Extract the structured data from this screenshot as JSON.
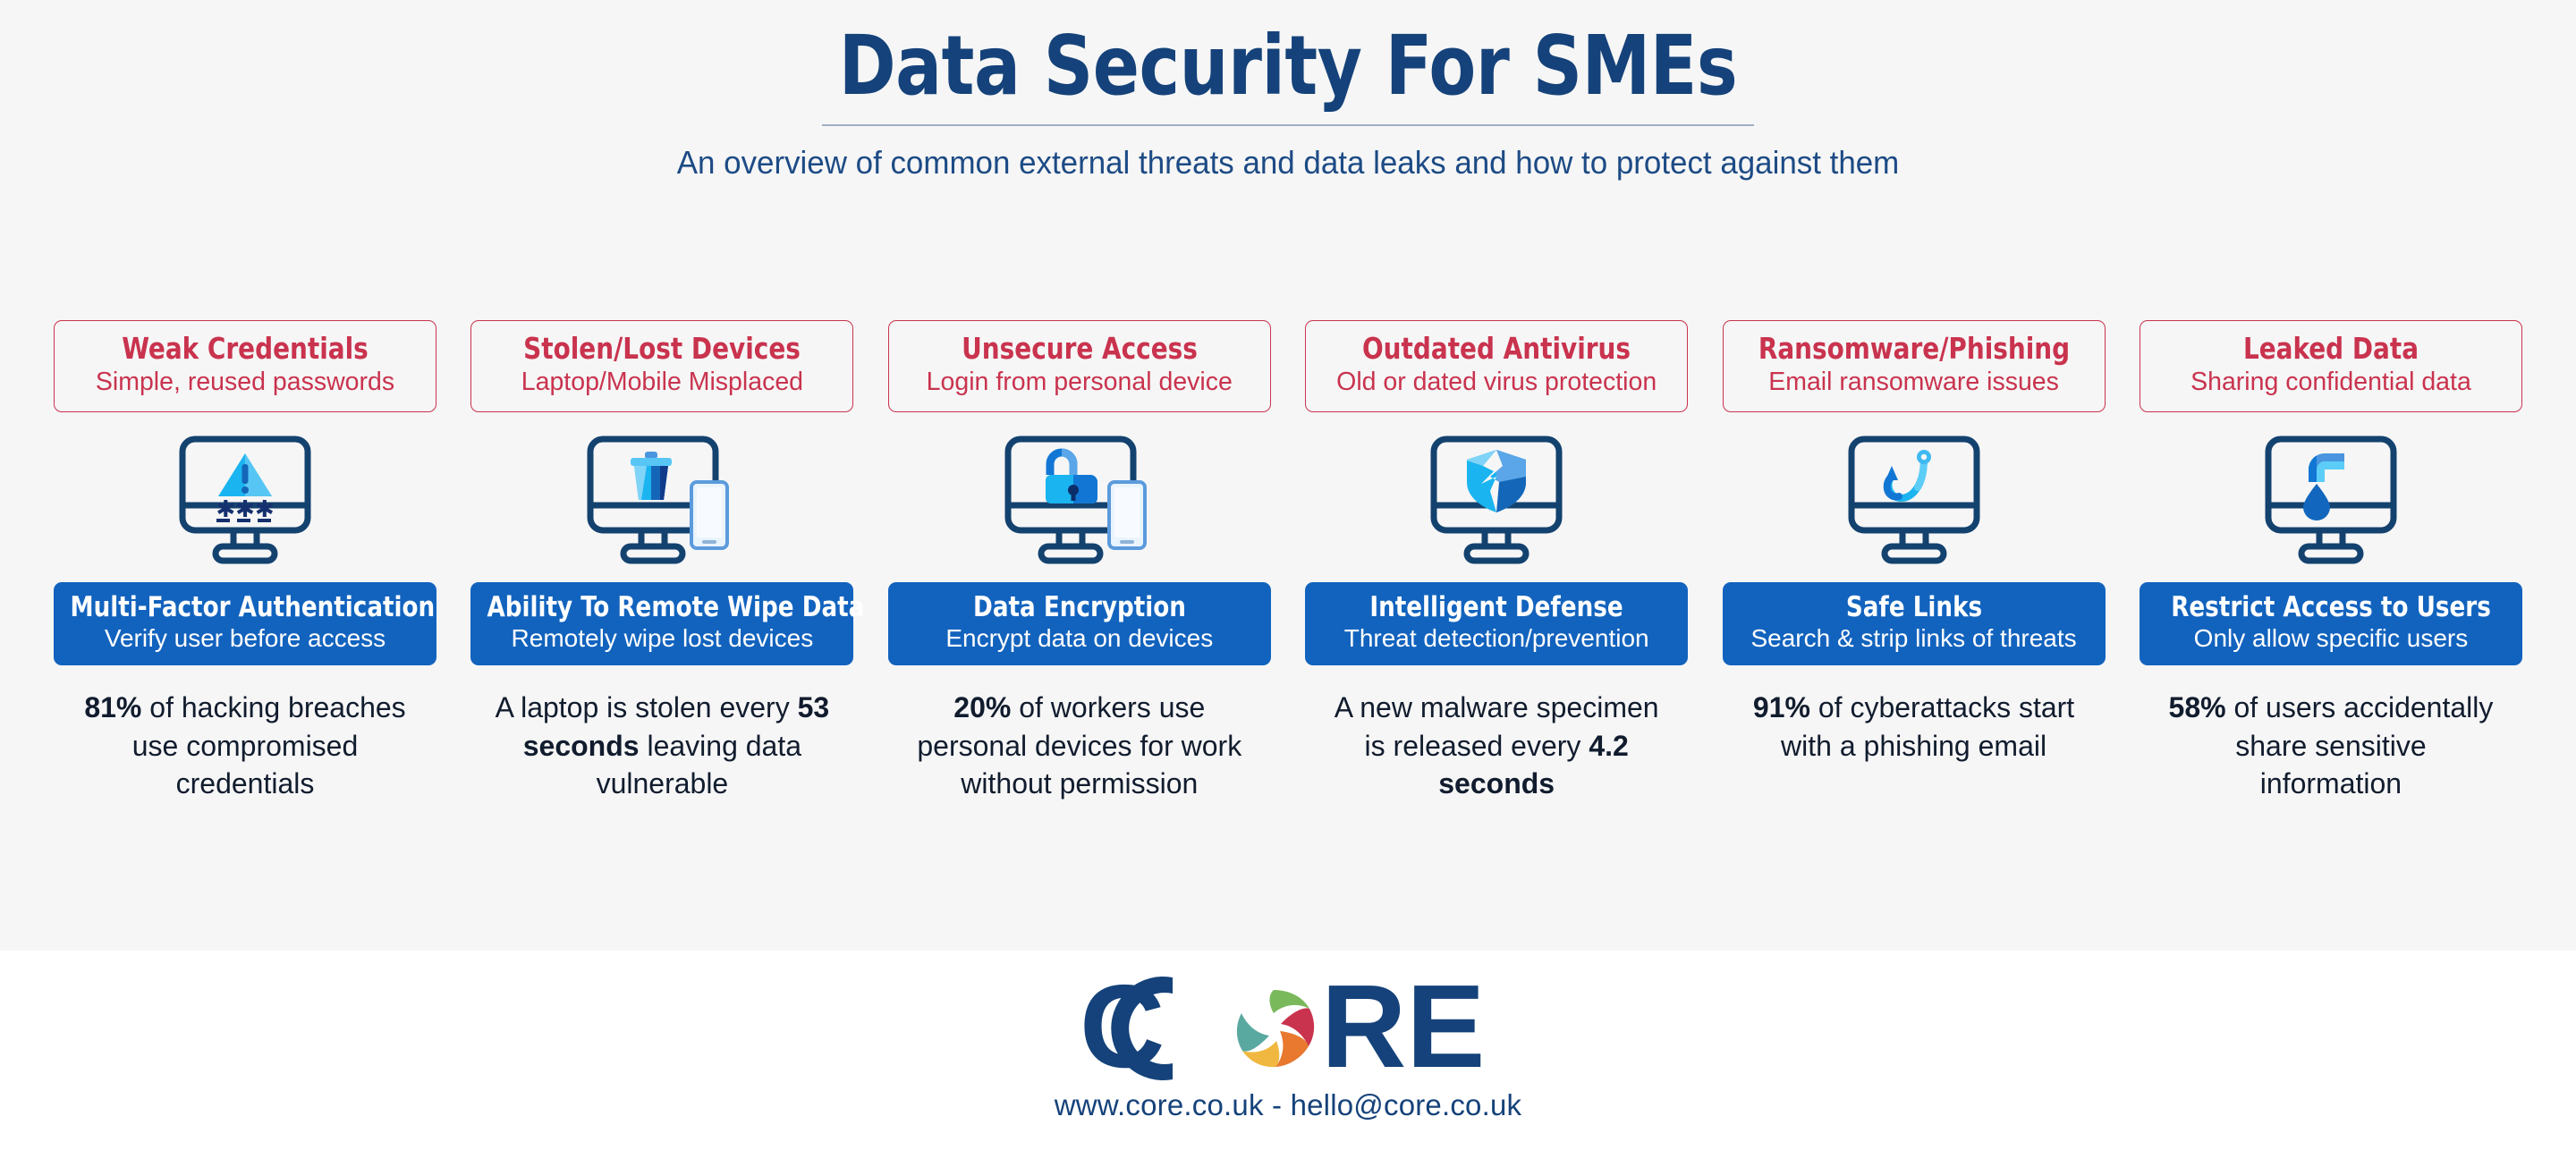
{
  "header": {
    "title": "Data Security For SMEs",
    "subtitle": "An overview of common external threats and data leaks and how to protect against them"
  },
  "colors": {
    "navy": "#15427a",
    "threat_red": "#c9334e",
    "solution_blue": "#1263be",
    "background": "#f6f6f6",
    "footer_background": "#ffffff",
    "stat_text": "#111c2e",
    "icon_outline": "#14426f",
    "icon_light_blue": "#1ab4f0",
    "icon_mid_blue": "#1277d4",
    "icon_pale_blue": "#6fcff5"
  },
  "cards": [
    {
      "threat_title": "Weak Credentials",
      "threat_sub": "Simple, reused passwords",
      "icon": "monitor-warning-password-icon",
      "solution_title": "Multi-Factor Authentication",
      "solution_sub": "Verify user before access",
      "stat_parts": [
        {
          "text": "81%",
          "bold": true
        },
        {
          "text": " of hacking breaches use compromised credentials",
          "bold": false
        }
      ],
      "stat_plain": "81% of hacking breaches use compromised credentials"
    },
    {
      "threat_title": "Stolen/Lost Devices",
      "threat_sub": "Laptop/Mobile Misplaced",
      "icon": "monitor-trash-phone-icon",
      "solution_title": "Ability To Remote Wipe Data",
      "solution_sub": "Remotely wipe lost devices",
      "stat_parts": [
        {
          "text": "A laptop is stolen every ",
          "bold": false
        },
        {
          "text": "53 seconds",
          "bold": true
        },
        {
          "text": " leaving data vulnerable",
          "bold": false
        }
      ],
      "stat_plain": "A laptop is stolen every 53 seconds leaving data vulnerable"
    },
    {
      "threat_title": "Unsecure Access",
      "threat_sub": "Login from personal device",
      "icon": "monitor-open-padlock-phone-icon",
      "solution_title": "Data Encryption",
      "solution_sub": "Encrypt data on devices",
      "stat_parts": [
        {
          "text": "20%",
          "bold": true
        },
        {
          "text": " of workers use personal devices for work without permission",
          "bold": false
        }
      ],
      "stat_plain": "20% of workers use personal devices for work without permission"
    },
    {
      "threat_title": "Outdated Antivirus",
      "threat_sub": "Old or dated virus protection",
      "icon": "monitor-cracked-shield-icon",
      "solution_title": "Intelligent Defense",
      "solution_sub": "Threat detection/prevention",
      "stat_parts": [
        {
          "text": "A new malware specimen is released every ",
          "bold": false
        },
        {
          "text": "4.2 seconds",
          "bold": true
        }
      ],
      "stat_plain": "A new malware specimen is released every 4.2 seconds"
    },
    {
      "threat_title": "Ransomware/Phishing",
      "threat_sub": "Email ransomware issues",
      "icon": "monitor-fishing-hook-icon",
      "solution_title": "Safe Links",
      "solution_sub": "Search & strip links of threats",
      "stat_parts": [
        {
          "text": "91%",
          "bold": true
        },
        {
          "text": " of cyberattacks start with a phishing email",
          "bold": false
        }
      ],
      "stat_plain": "91% of cyberattacks start with a phishing email"
    },
    {
      "threat_title": "Leaked Data",
      "threat_sub": "Sharing confidential data",
      "icon": "monitor-leaking-pipe-icon",
      "solution_title": "Restrict Access to Users",
      "solution_sub": "Only allow specific users",
      "stat_parts": [
        {
          "text": "58%",
          "bold": true
        },
        {
          "text": " of users accidentally share sensitive information",
          "bold": false
        }
      ],
      "stat_plain": "58% of users accidentally share sensitive information"
    }
  ],
  "footer": {
    "logo_text": "CORE",
    "logo_letters_before": "C",
    "logo_letters_after": "RE",
    "logo_aperture_colors": [
      "#7ab85c",
      "#c9334e",
      "#e8792e",
      "#f0b840",
      "#5aa9a0"
    ],
    "contact": "www.core.co.uk - hello@core.co.uk"
  }
}
